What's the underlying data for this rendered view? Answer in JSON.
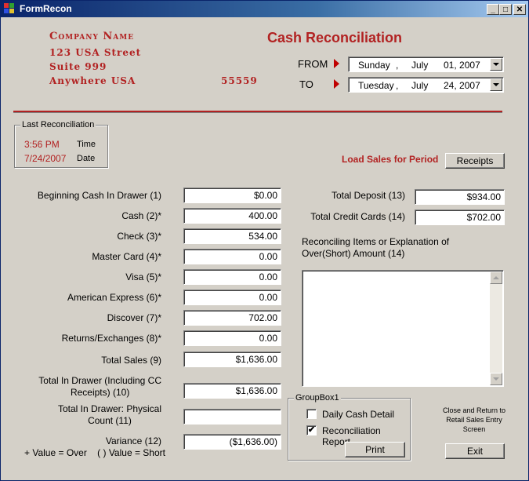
{
  "window": {
    "title": "FormRecon",
    "min_label": "_",
    "max_label": "□",
    "close_label": "✕"
  },
  "company": {
    "name": "Company Name",
    "street": "123 USA Street",
    "suite": "Suite 999",
    "city": "Anywhere USA",
    "zip": "55559"
  },
  "heading": "Cash Reconciliation",
  "from": {
    "label": "FROM",
    "weekday": "Sunday",
    "month": "July",
    "day": "01",
    "year": "2007",
    "sep1": ",",
    "sep2": ","
  },
  "to": {
    "label": "TO",
    "weekday": "Tuesday",
    "month": "July",
    "day": "24",
    "year": "2007",
    "sep1": ",",
    "sep2": ","
  },
  "last_recon": {
    "title": "Last Reconciliation",
    "time_value": "3:56 PM",
    "time_label": "Time",
    "date_value": "7/24/2007",
    "date_label": "Date"
  },
  "load_sales": {
    "label": "Load Sales for Period",
    "button": "Receipts"
  },
  "fields": [
    {
      "label": "Beginning Cash In Drawer (1)",
      "value": "$0.00"
    },
    {
      "label": "Cash (2)*",
      "value": "400.00"
    },
    {
      "label": "Check (3)*",
      "value": "534.00"
    },
    {
      "label": "Master Card (4)*",
      "value": "0.00"
    },
    {
      "label": "Visa (5)*",
      "value": "0.00"
    },
    {
      "label": "American Express (6)*",
      "value": "0.00"
    },
    {
      "label": "Discover (7)*",
      "value": "702.00"
    },
    {
      "label": "Returns/Exchanges (8)*",
      "value": "0.00"
    },
    {
      "label": "Total Sales (9)",
      "value": "$1,636.00"
    }
  ],
  "total_drawer_cc": {
    "label_line1": "Total In Drawer (Including CC",
    "label_line2": "Receipts) (10)",
    "value": "$1,636.00"
  },
  "total_drawer_physical": {
    "label_line1": "Total In Drawer: Physical",
    "label_line2": "Count (11)",
    "value": ""
  },
  "variance": {
    "label": "Variance (12)",
    "value": "($1,636.00)",
    "hint": "+ Value = Over    ( ) Value = Short"
  },
  "total_deposit": {
    "label": "Total Deposit (13)",
    "value": "$934.00"
  },
  "total_credit_cards": {
    "label": "Total Credit Cards (14)",
    "value": "$702.00"
  },
  "reconciling": {
    "label_line1": "Reconciling Items or Explanation of",
    "label_line2": "Over(Short) Amount (14)",
    "text": ""
  },
  "groupbox": {
    "title": "GroupBox1",
    "daily_cash_detail": "Daily Cash Detail",
    "daily_checked": false,
    "recon_report": "Reconciliation Report",
    "recon_checked": true,
    "check_mark": "✔",
    "print": "Print"
  },
  "exit": {
    "note_line1": "Close and Return to",
    "note_line2": "Retail Sales Entry",
    "note_line3": "Screen",
    "button": "Exit"
  },
  "colors": {
    "accent_red": "#b22222",
    "title_bar": "#0a246a",
    "face": "#d4d0c8"
  }
}
